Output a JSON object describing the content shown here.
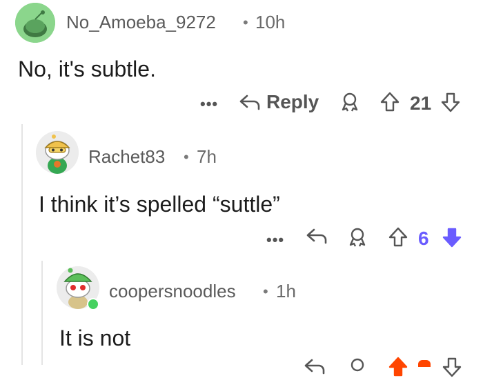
{
  "colors": {
    "text": "#1c1c1c",
    "meta": "#6a6a6a",
    "action": "#555555",
    "downvote_active": "#6a5cff",
    "upvote_active": "#ff4500",
    "online_dot": "#46d160",
    "thread_line": "#e4e4e4"
  },
  "comments": [
    {
      "username": "No_Amoeba_9272",
      "separator": "•",
      "time": "10h",
      "body": "No, it's subtle.",
      "actions": {
        "more": "•••",
        "reply_label": "Reply",
        "score": "21",
        "vote_state": "none"
      },
      "avatar_icon": "reddit-snoo-avatar-green"
    },
    {
      "username": "Rachet83",
      "separator": "•",
      "time": "7h",
      "body": "I think it’s spelled “suttle”",
      "actions": {
        "more": "•••",
        "score": "6",
        "vote_state": "downvoted"
      },
      "avatar_icon": "reddit-snoo-avatar-gold-helmet"
    },
    {
      "username": "coopersnoodles",
      "separator": "•",
      "time": "1h",
      "body": "It is not",
      "actions": {
        "vote_state": "upvoted"
      },
      "avatar_icon": "reddit-snoo-avatar-green-hat"
    }
  ]
}
